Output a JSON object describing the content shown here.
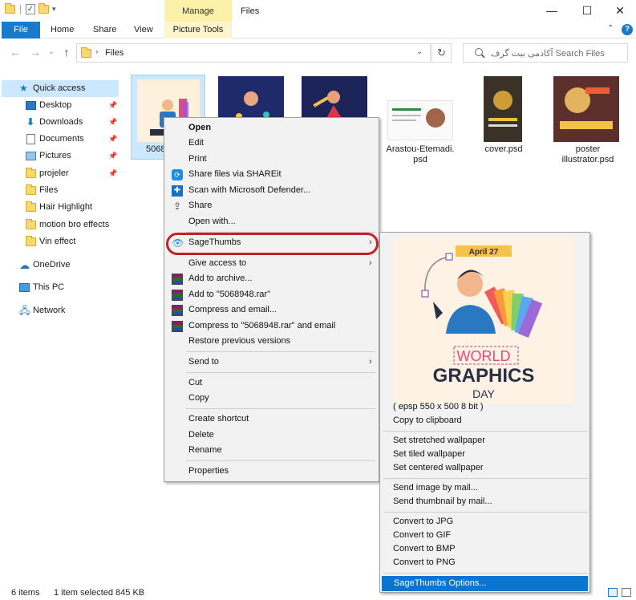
{
  "titlebar": {
    "manage_tab": "Manage",
    "window_title": "Files",
    "minimize": "—",
    "maximize": "☐",
    "close": "✕"
  },
  "ribbon": {
    "file_tab": "File",
    "tabs": [
      "Home",
      "Share",
      "View"
    ],
    "picture_tools_tab": "Picture Tools",
    "help": "?"
  },
  "address": {
    "path": "Files",
    "search_placeholder": "آکادمی بیت گرف  Search Files"
  },
  "sidebar": {
    "items": [
      {
        "label": "Quick access",
        "icon": "star-icon",
        "pinned": false
      },
      {
        "label": "Desktop",
        "icon": "desktop-icon",
        "pinned": true
      },
      {
        "label": "Downloads",
        "icon": "download-icon",
        "pinned": true
      },
      {
        "label": "Documents",
        "icon": "documents-icon",
        "pinned": true
      },
      {
        "label": "Pictures",
        "icon": "pictures-icon",
        "pinned": true
      },
      {
        "label": "projeler",
        "icon": "folder-icon",
        "pinned": true
      },
      {
        "label": "Files",
        "icon": "folder-icon",
        "pinned": false
      },
      {
        "label": "Hair Highlight",
        "icon": "folder-icon",
        "pinned": false
      },
      {
        "label": "motion bro effects",
        "icon": "folder-icon",
        "pinned": false
      },
      {
        "label": "Vin effect",
        "icon": "folder-icon",
        "pinned": false
      },
      {
        "label": "OneDrive",
        "icon": "onedrive-icon",
        "pinned": false
      },
      {
        "label": "This PC",
        "icon": "this-pc-icon",
        "pinned": false
      },
      {
        "label": "Network",
        "icon": "network-icon",
        "pinned": false
      }
    ]
  },
  "files": [
    {
      "name": "5068",
      "selected": true
    },
    {
      "name": "",
      "selected": false
    },
    {
      "name": "",
      "selected": false
    },
    {
      "name": "Arastou-Etemadi.\npsd",
      "selected": false
    },
    {
      "name": "cover.psd",
      "selected": false
    },
    {
      "name": "poster\nillustrator.psd",
      "selected": false
    }
  ],
  "context_menu": {
    "items": [
      {
        "label": "Open",
        "bold": true
      },
      {
        "label": "Edit"
      },
      {
        "label": "Print"
      },
      {
        "label": "Share files via SHAREit",
        "icon": "shareit-icon"
      },
      {
        "label": "Scan with Microsoft Defender...",
        "icon": "defender-icon"
      },
      {
        "label": "Share",
        "icon": "share-icon"
      },
      {
        "label": "Open with..."
      },
      {
        "label": "SageThumbs",
        "icon": "sagethumbs-icon",
        "submenu": true
      },
      {
        "label": "Give access to",
        "submenu": true
      },
      {
        "label": "Add to archive...",
        "icon": "winrar-icon"
      },
      {
        "label": "Add to \"5068948.rar\"",
        "icon": "winrar-icon"
      },
      {
        "label": "Compress and email...",
        "icon": "winrar-icon"
      },
      {
        "label": "Compress to \"5068948.rar\" and email",
        "icon": "winrar-icon"
      },
      {
        "label": "Restore previous versions"
      },
      {
        "label": "Send to",
        "submenu": true
      },
      {
        "label": "Cut"
      },
      {
        "label": "Copy"
      },
      {
        "label": "Create shortcut"
      },
      {
        "label": "Delete"
      },
      {
        "label": "Rename"
      },
      {
        "label": "Properties"
      }
    ]
  },
  "submenu": {
    "preview": {
      "date": "April 27",
      "line1": "WORLD",
      "line2": "GRAPHICS",
      "line3": "DAY"
    },
    "items": [
      "( epsp 550 x 500 8 bit )",
      "Copy to clipboard",
      "Set stretched wallpaper",
      "Set tiled wallpaper",
      "Set centered wallpaper",
      "Send image by mail...",
      "Send thumbnail by mail...",
      "Convert to JPG",
      "Convert to GIF",
      "Convert to BMP",
      "Convert to PNG",
      "SageThumbs Options..."
    ]
  },
  "status": {
    "items_count": "6 items",
    "selection": "1 item selected  845 KB"
  },
  "colors": {
    "accent": "#1979ca",
    "selection": "#cce8ff",
    "highlight_ring": "#c42128",
    "menu_selected": "#0a74d1"
  }
}
